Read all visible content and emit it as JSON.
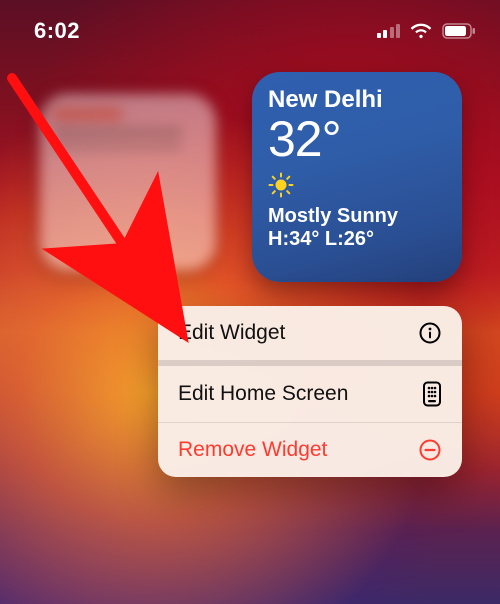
{
  "status": {
    "time": "6:02",
    "signal_active_bars": 2,
    "battery_percent": 82
  },
  "weather": {
    "city": "New Delhi",
    "temp": "32°",
    "condition": "Mostly Sunny",
    "high_low": "H:34° L:26°",
    "icon": "sun-icon"
  },
  "menu": {
    "items": [
      {
        "label": "Edit Widget",
        "icon": "info-circle-icon",
        "destructive": false
      },
      {
        "label": "Edit Home Screen",
        "icon": "homescreen-icon",
        "destructive": false
      },
      {
        "label": "Remove Widget",
        "icon": "minus-circle-icon",
        "destructive": true
      }
    ]
  },
  "colors": {
    "destructive": "#ff3b30",
    "widget_blue_top": "#2f5fb0",
    "widget_blue_bottom": "#233f7a",
    "arrow": "#ff0f0f"
  }
}
